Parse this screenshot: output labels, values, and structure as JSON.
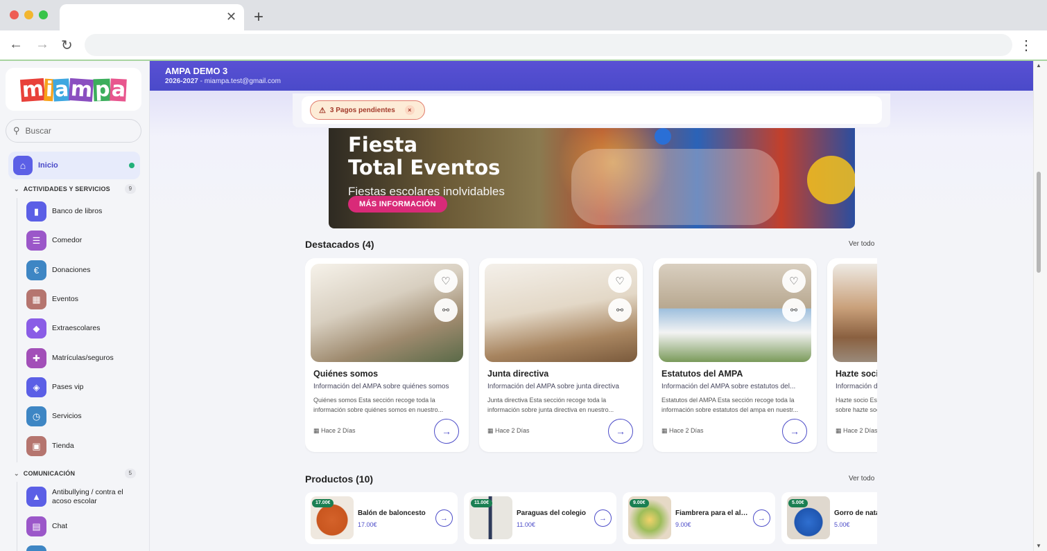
{
  "browser": {
    "tab_close": "✕",
    "new_tab": "+",
    "back": "←",
    "forward": "→",
    "reload": "↻",
    "menu": "⋮",
    "url": ""
  },
  "sidebar": {
    "logo": [
      "m",
      "i",
      "a",
      "m",
      "p",
      "a"
    ],
    "search_placeholder": "Buscar",
    "home": {
      "label": "Inicio",
      "icon": "home-icon"
    },
    "sections": [
      {
        "label": "ACTIVIDADES Y SERVICIOS",
        "count": "9"
      },
      {
        "label": "COMUNICACIÓN",
        "count": "5"
      }
    ],
    "activities": [
      {
        "label": "Banco de libros",
        "icon": "book-icon",
        "color": "#5b5fe6"
      },
      {
        "label": "Comedor",
        "icon": "list-icon",
        "color": "#9b57c9"
      },
      {
        "label": "Donaciones",
        "icon": "euro-icon",
        "color": "#3e86c4"
      },
      {
        "label": "Eventos",
        "icon": "calendar-icon",
        "color": "#b5756f"
      },
      {
        "label": "Extraescolares",
        "icon": "compass-icon",
        "color": "#8a5de6"
      },
      {
        "label": "Matrículas/seguros",
        "icon": "plus-square-icon",
        "color": "#a24fb8"
      },
      {
        "label": "Pases vip",
        "icon": "shield-icon",
        "color": "#5b5fe6"
      },
      {
        "label": "Servicios",
        "icon": "clock-icon",
        "color": "#3e86c4"
      },
      {
        "label": "Tienda",
        "icon": "cart-icon",
        "color": "#b5756f"
      }
    ],
    "communication": [
      {
        "label": "Antibullying / contra el acoso escolar",
        "icon": "warning-icon",
        "color": "#5b5fe6"
      },
      {
        "label": "Chat",
        "icon": "chat-icon",
        "color": "#9b57c9"
      }
    ]
  },
  "header": {
    "org": "AMPA DEMO 3",
    "year": "2026-2027",
    "email": " - miampa.test@gmail.com"
  },
  "alert": {
    "text": "3 Pagos pendientes",
    "close": "×"
  },
  "banner": {
    "title_line1": "Fiesta",
    "title_line2": "Total Eventos",
    "subtitle": "Fiestas escolares inolvidables",
    "button": "MÁS INFORMACIÓN"
  },
  "featured": {
    "title": "Destacados (4)",
    "see_all": "Ver todo",
    "cards": [
      {
        "title": "Quiénes somos",
        "desc": "Información del AMPA sobre quiénes somos",
        "excerpt": "Quiénes somos Esta sección recoge toda la información sobre quiénes somos en nuestro...",
        "date": "Hace 2 Días"
      },
      {
        "title": "Junta directiva",
        "desc": "Información del AMPA sobre junta directiva",
        "excerpt": "Junta directiva Esta sección recoge toda la información sobre junta directiva en nuestro...",
        "date": "Hace 2 Días"
      },
      {
        "title": "Estatutos del AMPA",
        "desc": "Información del AMPA sobre estatutos del...",
        "excerpt": "Estatutos del AMPA Esta sección recoge toda la información sobre estatutos del ampa en nuestr...",
        "date": "Hace 2 Días"
      },
      {
        "title": "Hazte socio",
        "desc": "Información del AMPA sobre hazte socio",
        "excerpt": "Hazte socio Esta sección recoge toda la información sobre hazte socio en nuestro...",
        "date": "Hace 2 Días"
      }
    ]
  },
  "products": {
    "title": "Productos (10)",
    "see_all": "Ver todo",
    "items": [
      {
        "name": "Balón de baloncesto",
        "price": "17.00€",
        "badge": "17.00€"
      },
      {
        "name": "Paraguas del colegio",
        "price": "11.00€",
        "badge": "11.00€"
      },
      {
        "name": "Fiambrera para el almuerzo",
        "price": "9.00€",
        "badge": "9.00€"
      },
      {
        "name": "Gorro de natación",
        "price": "5.00€",
        "badge": "5.00€"
      }
    ]
  }
}
